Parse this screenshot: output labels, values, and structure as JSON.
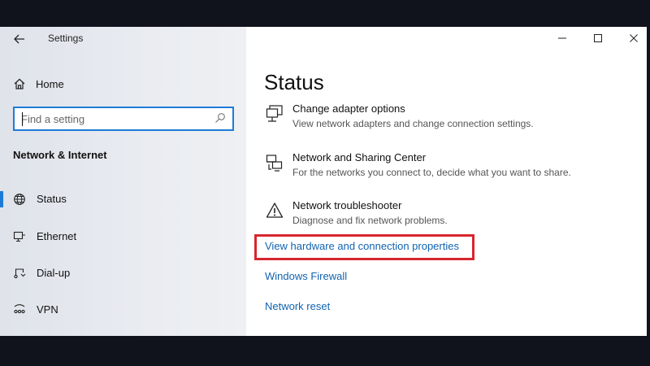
{
  "window": {
    "title": "Settings"
  },
  "sidebar": {
    "home_label": "Home",
    "search_placeholder": "Find a setting",
    "section_title": "Network & Internet",
    "items": [
      {
        "label": "Status",
        "icon": "globe-icon",
        "active": true
      },
      {
        "label": "Ethernet",
        "icon": "ethernet-icon",
        "active": false
      },
      {
        "label": "Dial-up",
        "icon": "dialup-icon",
        "active": false
      },
      {
        "label": "VPN",
        "icon": "vpn-icon",
        "active": false
      }
    ]
  },
  "main": {
    "title": "Status",
    "options": [
      {
        "title": "Change adapter options",
        "desc": "View network adapters and change connection settings.",
        "icon": "adapter-icon"
      },
      {
        "title": "Network and Sharing Center",
        "desc": "For the networks you connect to, decide what you want to share.",
        "icon": "sharing-icon"
      },
      {
        "title": "Network troubleshooter",
        "desc": "Diagnose and fix network problems.",
        "icon": "warning-icon"
      }
    ],
    "links": [
      {
        "label": "View hardware and connection properties",
        "highlighted": true
      },
      {
        "label": "Windows Firewall"
      },
      {
        "label": "Network reset"
      }
    ]
  },
  "colors": {
    "accent": "#1d7bd6",
    "link": "#1163b0",
    "highlight_box": "#d7262e"
  }
}
